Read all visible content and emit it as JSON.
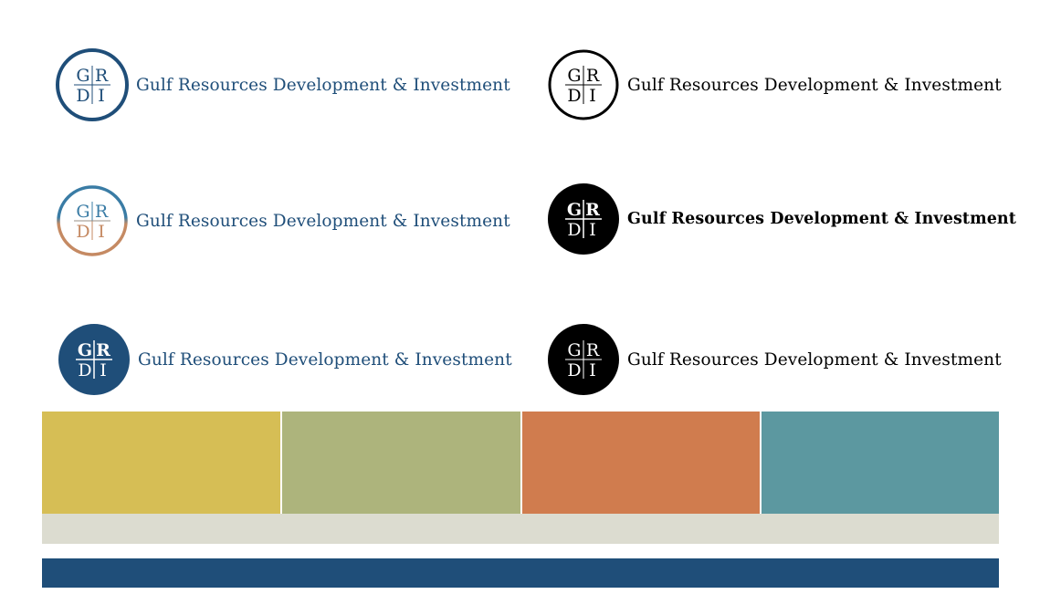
{
  "brand": {
    "monogram": {
      "tl": "G",
      "tr": "R",
      "bl": "D",
      "br": "I"
    },
    "name": "Gulf Resources Development & Investment"
  },
  "logos": [
    {
      "variant": "outline-blue",
      "emblem_colors": {
        "ring": "#1f4e79",
        "letters": "#1f4e79",
        "fill": "#ffffff"
      },
      "text_color": "#1f4e79"
    },
    {
      "variant": "outline-black",
      "emblem_colors": {
        "ring": "#000000",
        "letters": "#000000",
        "fill": "#ffffff"
      },
      "text_color": "#000000"
    },
    {
      "variant": "outline-gradient",
      "emblem_colors": {
        "ring_top": "#3a7ca5",
        "ring_bottom": "#c58a63",
        "letters_top": "#3a7ca5",
        "letters_bottom": "#c58a63",
        "fill": "#ffffff"
      },
      "text_color": "#1f4e79"
    },
    {
      "variant": "solid-black-bold",
      "emblem_colors": {
        "fill": "#000000",
        "letters": "#ffffff"
      },
      "text_color": "#000000"
    },
    {
      "variant": "solid-blue",
      "emblem_colors": {
        "fill": "#1f4e79",
        "letters": "#ffffff"
      },
      "text_color": "#1f4e79"
    },
    {
      "variant": "solid-black",
      "emblem_colors": {
        "fill": "#000000",
        "letters": "#ffffff"
      },
      "text_color": "#000000"
    }
  ],
  "palette": {
    "primary_swatches": [
      "#d6be55",
      "#adb47c",
      "#d07c4e",
      "#5c98a0"
    ],
    "neutral": "#dcdcd0",
    "navy": "#1f4e79"
  }
}
